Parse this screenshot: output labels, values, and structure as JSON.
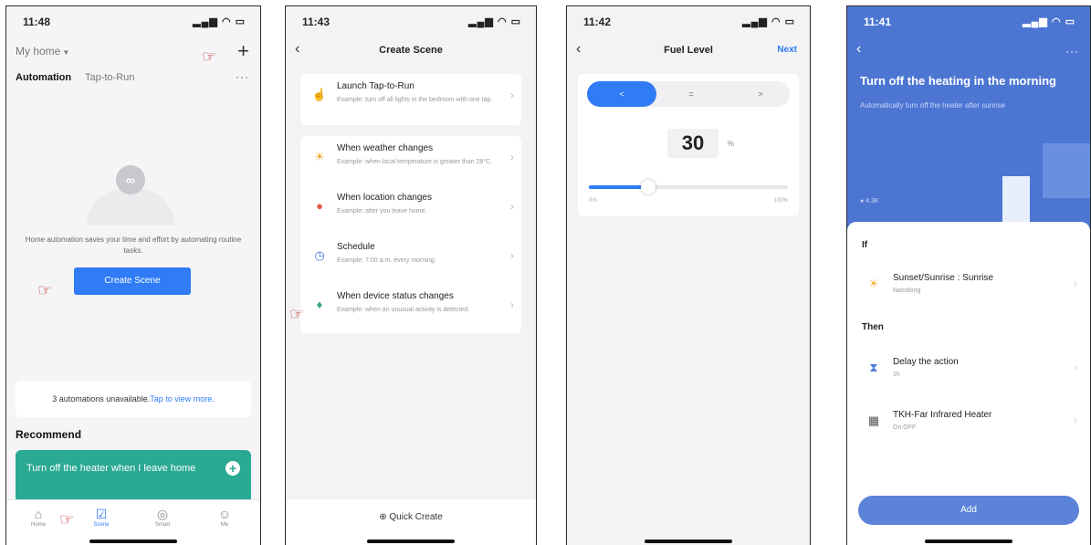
{
  "phone1": {
    "time": "11:48",
    "home_label": "My home",
    "tabs": [
      "Automation",
      "Tap-to-Run"
    ],
    "more": "···",
    "empty_text": "Home automation saves your time and effort by automating routine tasks.",
    "create_scene": "Create Scene",
    "unavailable_text": "3 automations unavailable.",
    "unavailable_link": "Tap to view more.",
    "recommend_title": "Recommend",
    "recommend_card": "Turn off the heater when I leave home",
    "tabbar": [
      "Home",
      "Scene",
      "Smart",
      "Me"
    ]
  },
  "phone2": {
    "time": "11:43",
    "title": "Create Scene",
    "rows": [
      {
        "title": "Launch Tap-to-Run",
        "sub": "Example: turn off all lights in the bedroom with one tap."
      },
      {
        "title": "When weather changes",
        "sub": "Example: when local temperature is greater than 28°C."
      },
      {
        "title": "When location changes",
        "sub": "Example: after you leave home."
      },
      {
        "title": "Schedule",
        "sub": "Example: 7:00 a.m. every morning."
      },
      {
        "title": "When device status changes",
        "sub": "Example: when an unusual activity is detected."
      }
    ],
    "quick_create": "Quick Create"
  },
  "phone3": {
    "time": "11:42",
    "title": "Fuel Level",
    "next": "Next",
    "segments": [
      "<",
      "=",
      ">"
    ],
    "selected_segment": 0,
    "value": "30",
    "unit": "%",
    "slider_fraction": 0.3,
    "range_min": "0%",
    "range_max": "100%"
  },
  "phone4": {
    "time": "11:41",
    "title": "Turn off the heating in the morning",
    "subtitle": "Automatically turn off the heater after sunrise",
    "count": "4.3K",
    "if_label": "If",
    "then_label": "Then",
    "if_row": {
      "title": "Sunset/Sunrise : Sunrise",
      "sub": "Namdong"
    },
    "then_rows": [
      {
        "title": "Delay the action",
        "sub": "1h"
      },
      {
        "title": "TKH-Far Infrared Heater",
        "sub": "On:OFF"
      }
    ],
    "add": "Add"
  },
  "colors": {
    "accent": "#2f7cf6",
    "teal": "#2aa993",
    "hero": "#4d76d3",
    "pointer": "#c62828"
  }
}
